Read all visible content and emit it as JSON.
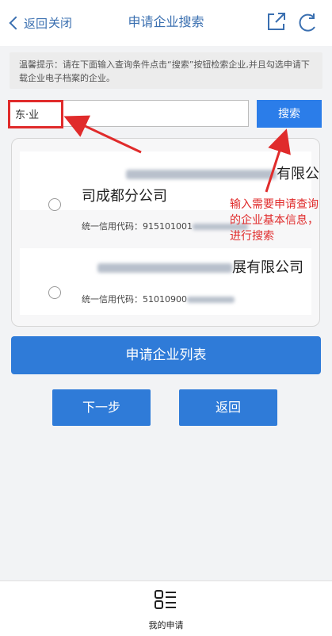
{
  "header": {
    "back_label": "返回",
    "close_label": "关闭",
    "title": "申请企业搜索"
  },
  "notice": {
    "text": "温馨提示：请在下面输入查询条件点击“搜索”按钮检索企业,并且勾选申请下载企业电子档案的企业。"
  },
  "search": {
    "value": "东·业",
    "button_label": "搜索"
  },
  "results": [
    {
      "name_line1_suffix": "有限公",
      "name_line2": "司成都分公司",
      "credit_prefix": "统一信用代码：",
      "credit_code_visible": "915101001"
    },
    {
      "name_suffix": "展有限公司",
      "credit_prefix": "统一信用代码：",
      "credit_code_visible": "51010900"
    }
  ],
  "annotation": {
    "text": "输入需要申请查询的企业基本信息，进行搜索",
    "color": "#e02b2b"
  },
  "buttons": {
    "list_label": "申请企业列表",
    "next_label": "下一步",
    "return_label": "返回"
  },
  "bottom_nav": {
    "label": "我的申请"
  },
  "colors": {
    "primary": "#2f7bd8",
    "link": "#3a6fb0",
    "annotation": "#e02b2b"
  }
}
